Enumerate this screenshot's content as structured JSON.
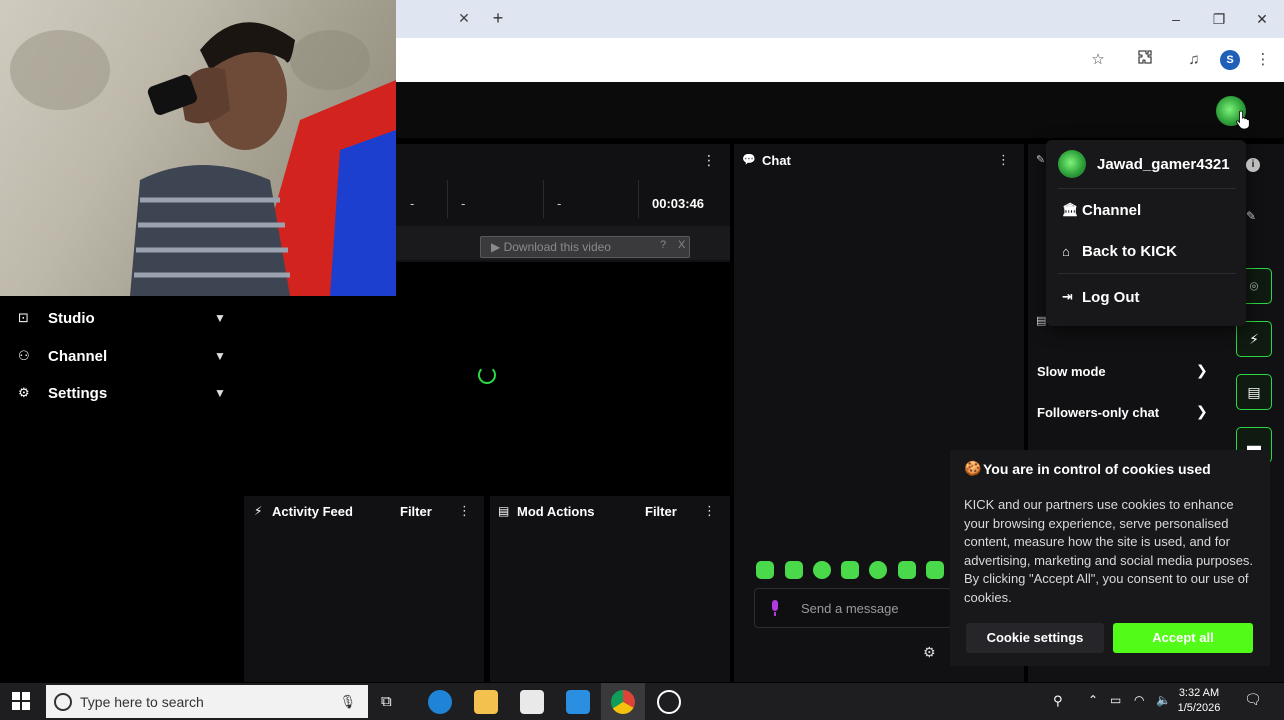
{
  "browser": {
    "tab_close": "✕",
    "new_tab": "+",
    "profile_initial": "S"
  },
  "sidebar": {
    "items": [
      {
        "label": "Studio"
      },
      {
        "label": "Channel"
      },
      {
        "label": "Settings"
      }
    ]
  },
  "video": {
    "stat_1": "-",
    "stat_2": "-",
    "stat_3": "-",
    "duration": "00:03:46",
    "download_label": "▶ Download this video",
    "download_help": "?",
    "download_close": "X"
  },
  "panels": {
    "activity_title": "Activity Feed",
    "activity_filter": "Filter",
    "mod_title": "Mod Actions",
    "mod_filter": "Filter",
    "chat_title": "Chat",
    "message_placeholder": "Send a message"
  },
  "right_panel": {
    "slow_mode": "Slow mode",
    "followers_only": "Followers-only chat"
  },
  "dropdown": {
    "username": "Jawad_gamer4321",
    "items": [
      {
        "label": "Channel"
      },
      {
        "label": "Back to KICK"
      },
      {
        "label": "Log Out"
      }
    ]
  },
  "cookie": {
    "title": "You are in control of cookies used",
    "body": "KICK and our partners use cookies to enhance your browsing experience, serve personalised content, measure how the site is used, and for advertising, marketing and social media purposes. By clicking \"Accept All\", you consent to our use of cookies.",
    "settings_label": "Cookie settings",
    "accept_label": "Accept all"
  },
  "taskbar": {
    "search_placeholder": "Type here to search",
    "time": "3:32 AM",
    "date": "1/5/2026"
  },
  "colors": {
    "accent": "#53fc18",
    "panel": "#111113",
    "background": "#000000"
  }
}
